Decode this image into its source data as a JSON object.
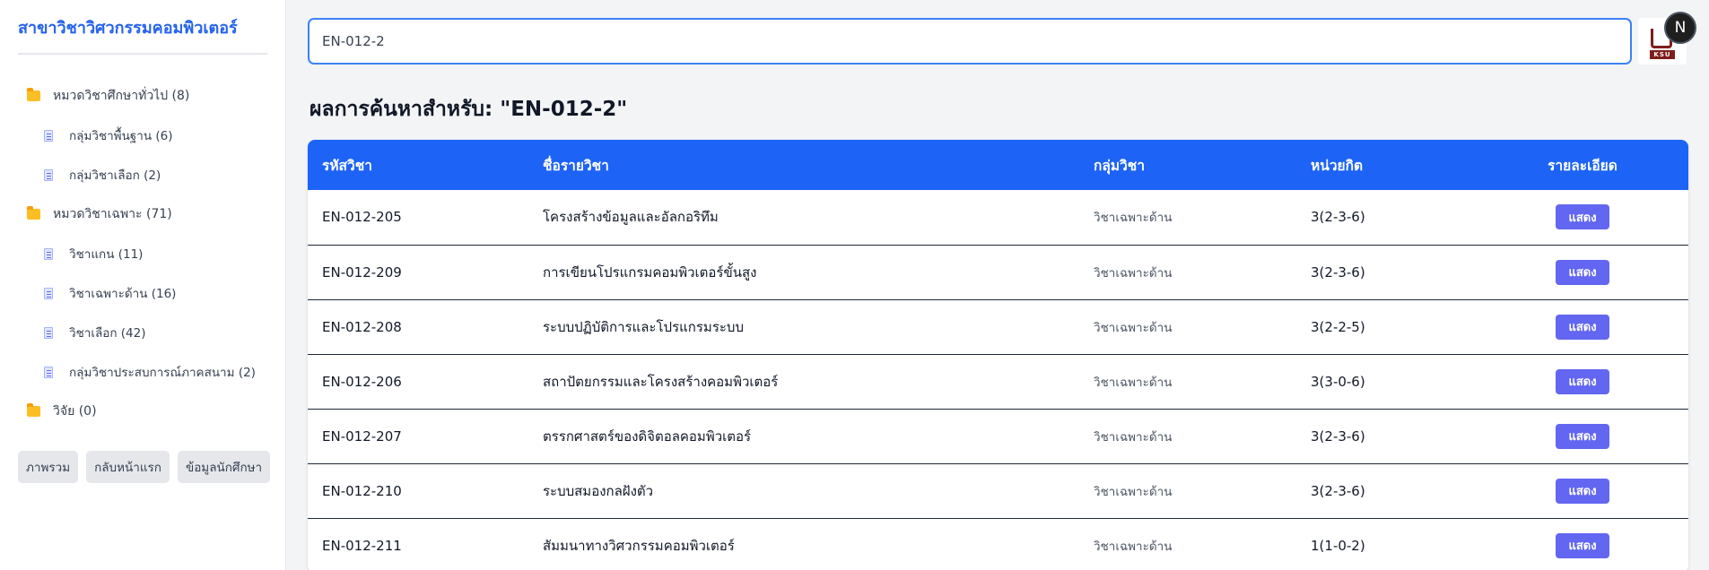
{
  "sidebar": {
    "title": "สาขาวิชาวิศวกรรมคอมพิวเตอร์",
    "tree": [
      {
        "label": "หมวดวิชาศึกษาทั่วไป (8)",
        "icon": "folder-icon"
      },
      {
        "label": "กลุ่มวิชาพื้นฐาน (6)",
        "icon": "document-icon"
      },
      {
        "label": "กลุ่มวิชาเลือก (2)",
        "icon": "document-icon"
      },
      {
        "label": "หมวดวิชาเฉพาะ (71)",
        "icon": "folder-icon"
      },
      {
        "label": "วิชาแกน (11)",
        "icon": "document-icon"
      },
      {
        "label": "วิชาเฉพาะด้าน (16)",
        "icon": "document-icon"
      },
      {
        "label": "วิชาเลือก (42)",
        "icon": "document-icon"
      },
      {
        "label": "กลุ่มวิชาประสบการณ์ภาคสนาม (2)",
        "icon": "document-icon"
      },
      {
        "label": "วิจัย (0)",
        "icon": "folder-icon"
      }
    ],
    "buttons": [
      "ภาพรวม",
      "กลับหน้าแรก",
      "ข้อมูลนักศึกษา"
    ]
  },
  "search": {
    "value": "EN-012-2"
  },
  "logo": {
    "text": "KSU"
  },
  "avatar": {
    "initial": "N"
  },
  "results": {
    "heading": "ผลการค้นหาสำหรับ: \"EN-012-2\"",
    "columns": [
      "รหัสวิชา",
      "ชื่อรายวิชา",
      "กลุ่มวิชา",
      "หน่วยกิต",
      "รายละเอียด"
    ],
    "rows": [
      {
        "code": "EN-012-205",
        "name": "โครงสร้างข้อมูลและอัลกอริทึม",
        "group": "วิชาเฉพาะด้าน",
        "credits": "3(2-3-6)",
        "action": "แสดง"
      },
      {
        "code": "EN-012-209",
        "name": "การเขียนโปรแกรมคอมพิวเตอร์ขั้นสูง",
        "group": "วิชาเฉพาะด้าน",
        "credits": "3(2-3-6)",
        "action": "แสดง"
      },
      {
        "code": "EN-012-208",
        "name": "ระบบปฏิบัติการและโปรแกรมระบบ",
        "group": "วิชาเฉพาะด้าน",
        "credits": "3(2-2-5)",
        "action": "แสดง"
      },
      {
        "code": "EN-012-206",
        "name": "สถาปัตยกรรมและโครงสร้างคอมพิวเตอร์",
        "group": "วิชาเฉพาะด้าน",
        "credits": "3(3-0-6)",
        "action": "แสดง"
      },
      {
        "code": "EN-012-207",
        "name": "ตรรกศาสตร์ของดิจิตอลคอมพิวเตอร์",
        "group": "วิชาเฉพาะด้าน",
        "credits": "3(2-3-6)",
        "action": "แสดง"
      },
      {
        "code": "EN-012-210",
        "name": "ระบบสมองกลฝังตัว",
        "group": "วิชาเฉพาะด้าน",
        "credits": "3(2-3-6)",
        "action": "แสดง"
      },
      {
        "code": "EN-012-211",
        "name": "สัมมนาทางวิศวกรรมคอมพิวเตอร์",
        "group": "วิชาเฉพาะด้าน",
        "credits": "1(1-0-2)",
        "action": "แสดง"
      }
    ]
  },
  "colors": {
    "accent": "#1d63f5",
    "button": "#6366f1",
    "sidebar_title": "#2563eb"
  }
}
